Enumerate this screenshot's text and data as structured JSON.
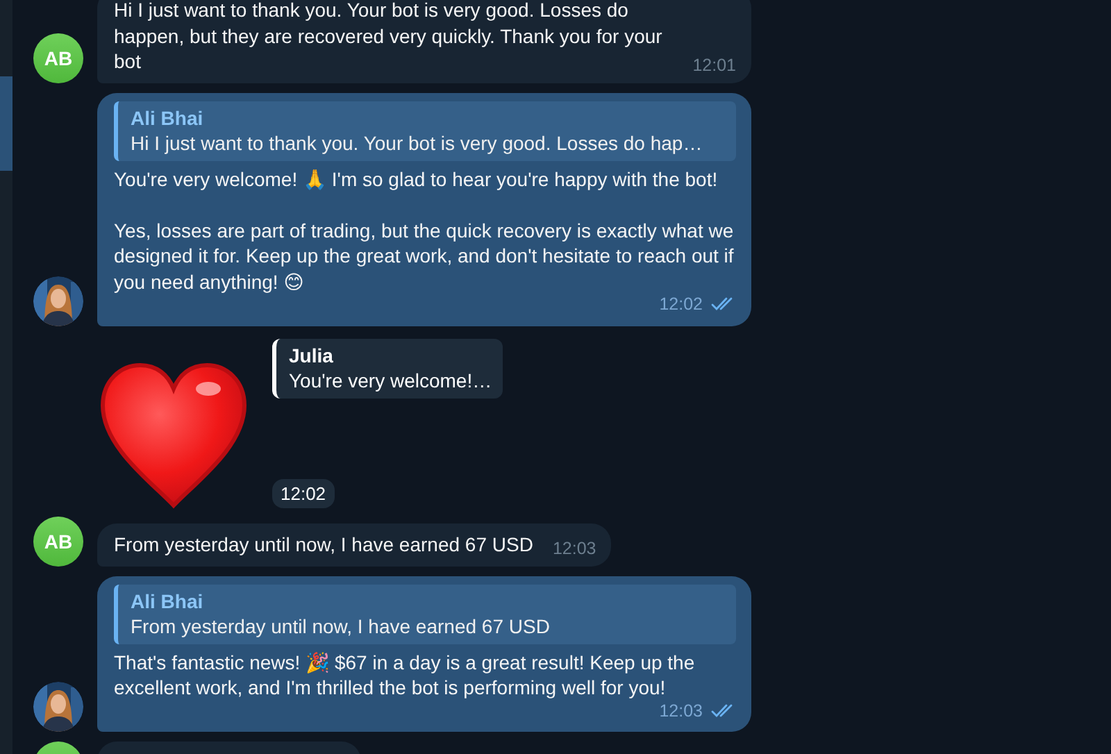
{
  "messages": [
    {
      "kind": "incoming",
      "avatar": "AB",
      "text": "Hi I just want to thank you. Your bot is very good. Losses do happen, but they are recovered very quickly. Thank you for your bot",
      "time": "12:01"
    },
    {
      "kind": "outgoing",
      "reply": {
        "name": "Ali Bhai",
        "text": "Hi I just want to thank you. Your bot is very good. Losses do hap…"
      },
      "text": "You're very welcome! 🙏 I'm so glad to hear you're happy with the bot!\n\nYes, losses are part of trading, but the quick recovery is exactly what we designed it for. Keep up the great work, and don't hesitate to reach out if you need anything! 😊",
      "time": "12:02",
      "read": true
    },
    {
      "kind": "sticker",
      "reply": {
        "name": "Julia",
        "text": "You're very welcome!…"
      },
      "time": "12:02"
    },
    {
      "kind": "incoming",
      "avatar": "AB",
      "text": "From yesterday until now, I have earned 67 USD",
      "time": "12:03"
    },
    {
      "kind": "outgoing",
      "reply": {
        "name": "Ali Bhai",
        "text": "From yesterday until now, I have earned 67 USD"
      },
      "text": "That's fantastic news! 🎉 $67 in a day is a great result! Keep up the excellent work, and I'm thrilled the bot is performing well for you!",
      "time": "12:03",
      "read": true
    },
    {
      "kind": "clipped"
    }
  ]
}
